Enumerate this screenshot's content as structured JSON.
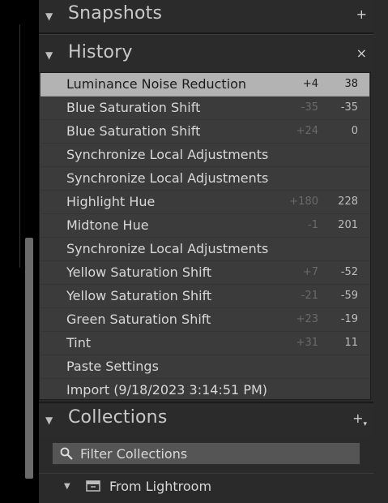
{
  "snapshots": {
    "title": "Snapshots",
    "action": "+"
  },
  "history": {
    "title": "History",
    "action": "×",
    "rows": [
      {
        "name": "Luminance Noise Reduction",
        "delta": "+4",
        "value": "38",
        "selected": true
      },
      {
        "name": "Blue Saturation Shift",
        "delta": "-35",
        "value": "-35"
      },
      {
        "name": "Blue Saturation Shift",
        "delta": "+24",
        "value": "0"
      },
      {
        "name": "Synchronize Local Adjustments",
        "delta": "",
        "value": ""
      },
      {
        "name": "Synchronize Local Adjustments",
        "delta": "",
        "value": ""
      },
      {
        "name": "Highlight Hue",
        "delta": "+180",
        "value": "228"
      },
      {
        "name": "Midtone Hue",
        "delta": "-1",
        "value": "201"
      },
      {
        "name": "Synchronize Local Adjustments",
        "delta": "",
        "value": ""
      },
      {
        "name": "Yellow Saturation Shift",
        "delta": "+7",
        "value": "-52"
      },
      {
        "name": "Yellow Saturation Shift",
        "delta": "-21",
        "value": "-59"
      },
      {
        "name": "Green Saturation Shift",
        "delta": "+23",
        "value": "-19"
      },
      {
        "name": "Tint",
        "delta": "+31",
        "value": "11"
      },
      {
        "name": "Paste Settings",
        "delta": "",
        "value": ""
      },
      {
        "name": "Import (9/18/2023 3:14:51 PM)",
        "delta": "",
        "value": ""
      }
    ]
  },
  "collections": {
    "title": "Collections",
    "action": "+",
    "filter_placeholder": "Filter Collections",
    "items": [
      {
        "label": "From Lightroom"
      }
    ]
  },
  "colors": {
    "selected_row": "#b3b3b3",
    "panel_bg": "#2a2a2a",
    "list_bg": "#3b3b3b"
  }
}
